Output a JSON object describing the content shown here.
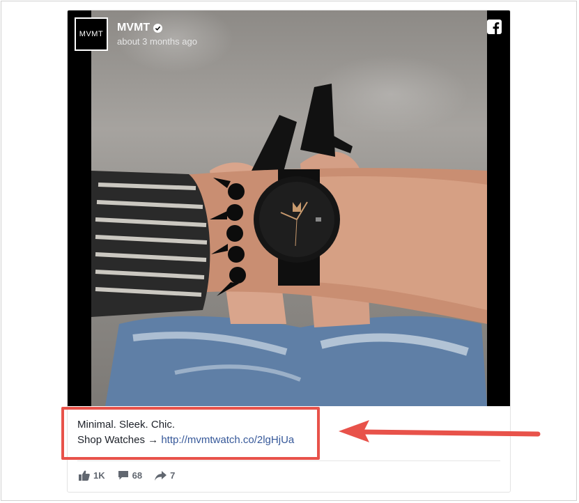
{
  "post": {
    "avatar_text": "MVMT",
    "name": "MVMT",
    "timestamp": "about 3 months ago",
    "caption_line1": "Minimal. Sleek. Chic.",
    "caption_line2_prefix": "Shop Watches → ",
    "caption_link": "http://mvmtwatch.co/2lgHjUa",
    "likes": "1K",
    "comments": "68",
    "shares": "7"
  },
  "colors": {
    "highlight": "#e8524a",
    "link": "#365899",
    "text": "#1d2129",
    "icon_gray": "#616770"
  },
  "icons": [
    "verified-badge-icon",
    "facebook-icon",
    "like-icon",
    "comment-icon",
    "share-icon",
    "annotation-arrow"
  ]
}
